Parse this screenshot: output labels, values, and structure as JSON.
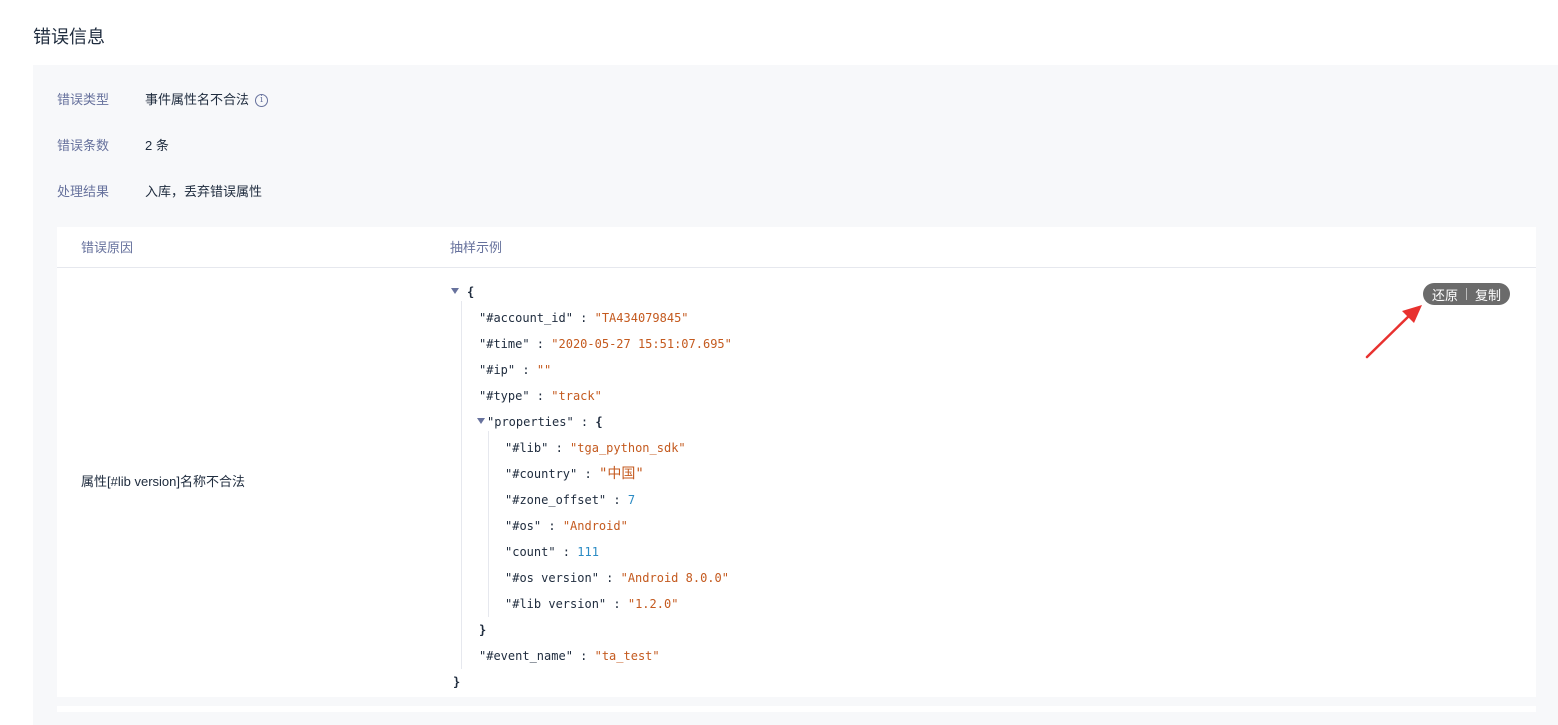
{
  "page": {
    "title": "错误信息"
  },
  "info": [
    {
      "label": "错误类型",
      "value": "事件属性名不合法",
      "has_info_icon": true
    },
    {
      "label": "错误条数",
      "value": "2 条"
    },
    {
      "label": "处理结果",
      "value": "入库，丢弃错误属性"
    }
  ],
  "table": {
    "headers": {
      "reason": "错误原因",
      "sample": "抽样示例"
    },
    "row": {
      "reason": "属性[#lib version]名称不合法"
    }
  },
  "actions": {
    "restore": "还原",
    "copy": "复制"
  },
  "json_sample": {
    "open_brace": "{",
    "close_brace": "}",
    "account_id_key": "\"#account_id\"",
    "account_id_val": "\"TA434079845\"",
    "time_key": "\"#time\"",
    "time_val": "\"2020-05-27 15:51:07.695\"",
    "ip_key": "\"#ip\"",
    "ip_val": "\"\"",
    "type_key": "\"#type\"",
    "type_val": "\"track\"",
    "properties_key": "\"properties\"",
    "lib_key": "\"#lib\"",
    "lib_val": "\"tga_python_sdk\"",
    "country_key": "\"#country\"",
    "country_val": "\"中国\"",
    "zone_offset_key": "\"#zone_offset\"",
    "zone_offset_val": "7",
    "os_key": "\"#os\"",
    "os_val": "\"Android\"",
    "count_key": "\"count\"",
    "count_val": "111",
    "os_version_key": "\"#os version\"",
    "os_version_val": "\"Android 8.0.0\"",
    "lib_version_key": "\"#lib version\"",
    "lib_version_val": "\"1.2.0\"",
    "event_name_key": "\"#event_name\"",
    "event_name_val": "\"ta_test\""
  },
  "colors": {
    "string": "#c45a1f",
    "number": "#2b8bc4",
    "annotation_arrow": "#e8312f",
    "pill_bg": "#6b6b6b"
  }
}
